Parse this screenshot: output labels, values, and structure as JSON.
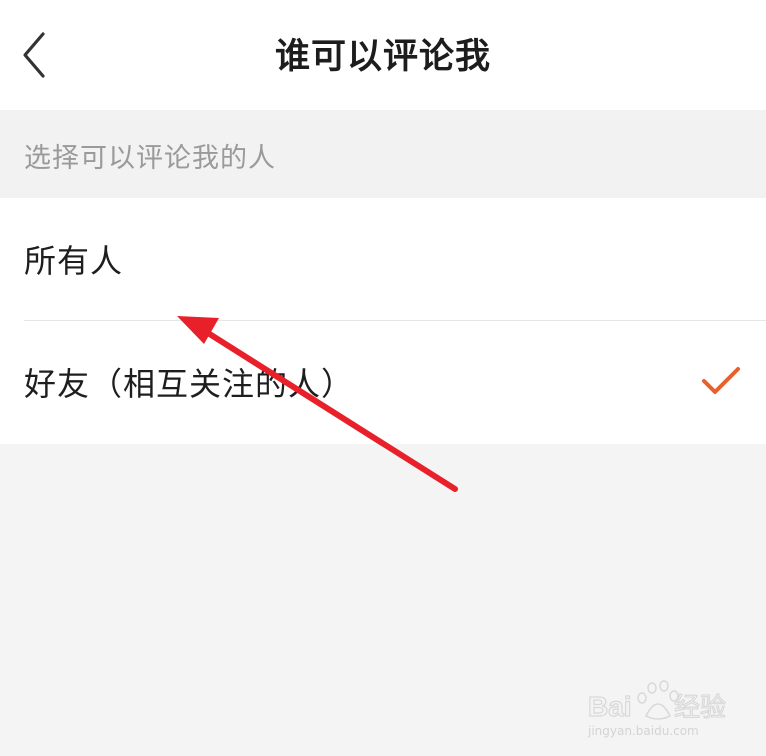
{
  "header": {
    "title": "谁可以评论我",
    "back_icon": "chevron-left-icon"
  },
  "section": {
    "label": "选择可以评论我的人"
  },
  "options": [
    {
      "label": "所有人",
      "selected": false
    },
    {
      "label": "好友（相互关注的人）",
      "selected": true
    }
  ],
  "colors": {
    "accent": "#e8602c",
    "annotation_arrow": "#e8202a"
  },
  "watermark": {
    "brand": "Baidu",
    "suffix": "经验",
    "url": "jingyan.baidu.com"
  }
}
